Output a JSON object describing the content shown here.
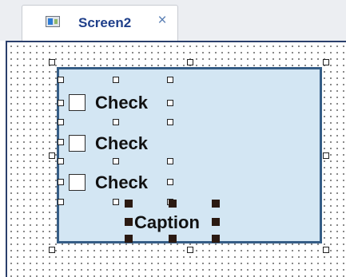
{
  "tab": {
    "label": "Screen2",
    "close_glyph": "×",
    "icon": "screen-icon"
  },
  "canvas": {
    "checkboxes": [
      {
        "label": "Check",
        "checked": false
      },
      {
        "label": "Check",
        "checked": false
      },
      {
        "label": "Check",
        "checked": false
      }
    ],
    "caption": {
      "label": "Caption",
      "selected": true
    },
    "panel": {
      "selected": true
    }
  },
  "colors": {
    "panel_fill": "#d3e6f3",
    "panel_border": "#355d86",
    "tab_text": "#1f3f8a",
    "selected_handle": "#2b1a12"
  }
}
